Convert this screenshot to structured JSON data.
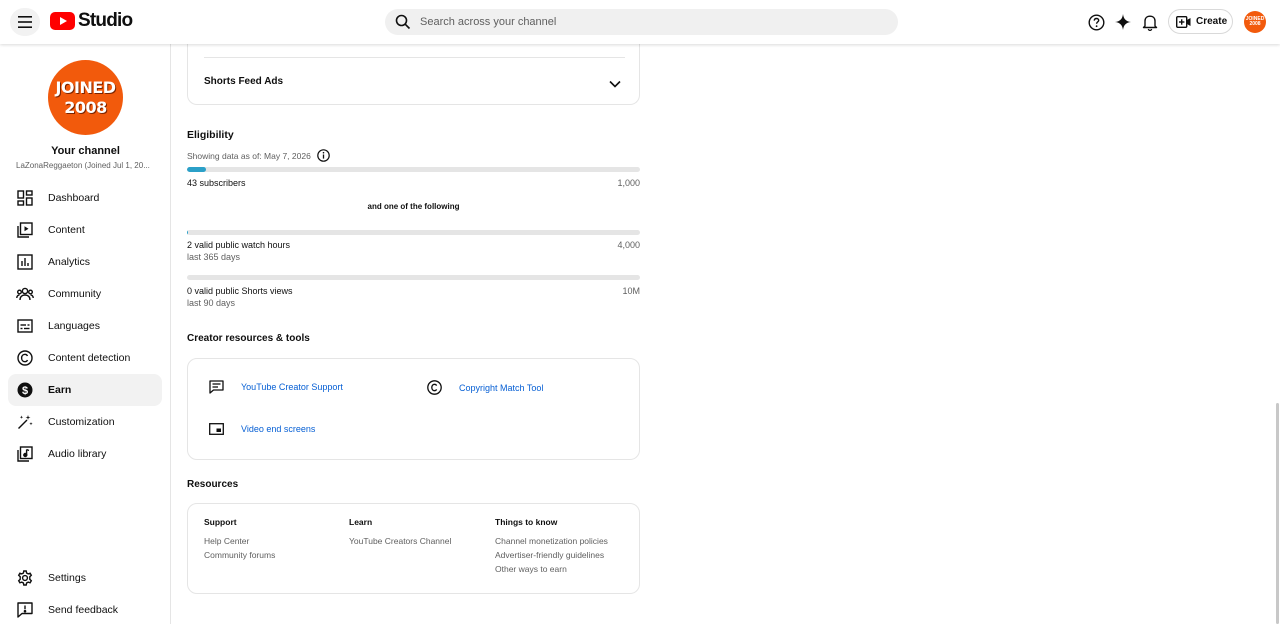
{
  "header": {
    "logo_text": "Studio",
    "search_placeholder": "Search across your channel",
    "create_label": "Create",
    "avatar_text_line1": "JOINED",
    "avatar_text_line2": "2008"
  },
  "sidebar": {
    "avatar_line1": "JOINED",
    "avatar_line2": "2008",
    "channel_title": "Your channel",
    "channel_subtitle": "LaZonaReggaeton (Joined Jul 1, 20...",
    "items": [
      {
        "label": "Dashboard",
        "icon": "dashboard-icon"
      },
      {
        "label": "Content",
        "icon": "content-icon"
      },
      {
        "label": "Analytics",
        "icon": "analytics-icon"
      },
      {
        "label": "Community",
        "icon": "community-icon"
      },
      {
        "label": "Languages",
        "icon": "languages-icon"
      },
      {
        "label": "Content detection",
        "icon": "content-detection-icon"
      },
      {
        "label": "Earn",
        "icon": "earn-icon",
        "active": true
      },
      {
        "label": "Customization",
        "icon": "customization-icon"
      },
      {
        "label": "Audio library",
        "icon": "audio-library-icon"
      }
    ],
    "bottom_items": [
      {
        "label": "Settings",
        "icon": "gear-icon"
      },
      {
        "label": "Send feedback",
        "icon": "feedback-icon"
      }
    ]
  },
  "main": {
    "shorts_feed_ads": "Shorts Feed Ads",
    "eligibility": {
      "title": "Eligibility",
      "as_of": "Showing data as of: May 7, 2026",
      "subscribers": {
        "current": "43 subscribers",
        "target": "1,000",
        "progress": 0.043
      },
      "and_one": "and one of the following",
      "watch_hours": {
        "current": "2 valid public watch hours",
        "period": "last 365 days",
        "target": "4,000",
        "progress": 0.0005
      },
      "shorts_views": {
        "current": "0 valid public Shorts views",
        "period": "last 90 days",
        "target": "10M",
        "progress": 0
      }
    },
    "creator_tools": {
      "title": "Creator resources & tools",
      "items": [
        {
          "label": "YouTube Creator Support",
          "icon": "chat-icon"
        },
        {
          "label": "Copyright Match Tool",
          "icon": "copyright-icon"
        },
        {
          "label": "Video end screens",
          "icon": "end-screen-icon"
        }
      ]
    },
    "resources": {
      "title": "Resources",
      "columns": [
        {
          "heading": "Support",
          "links": [
            "Help Center",
            "Community forums"
          ]
        },
        {
          "heading": "Learn",
          "links": [
            "YouTube Creators Channel"
          ]
        },
        {
          "heading": "Things to know",
          "links": [
            "Channel monetization policies",
            "Advertiser-friendly guidelines",
            "Other ways to earn"
          ]
        }
      ]
    }
  },
  "colors": {
    "brand_red": "#ff0000",
    "avatar_orange": "#f25a0c",
    "progress": "#2ba0c8",
    "link": "#065fd4"
  }
}
